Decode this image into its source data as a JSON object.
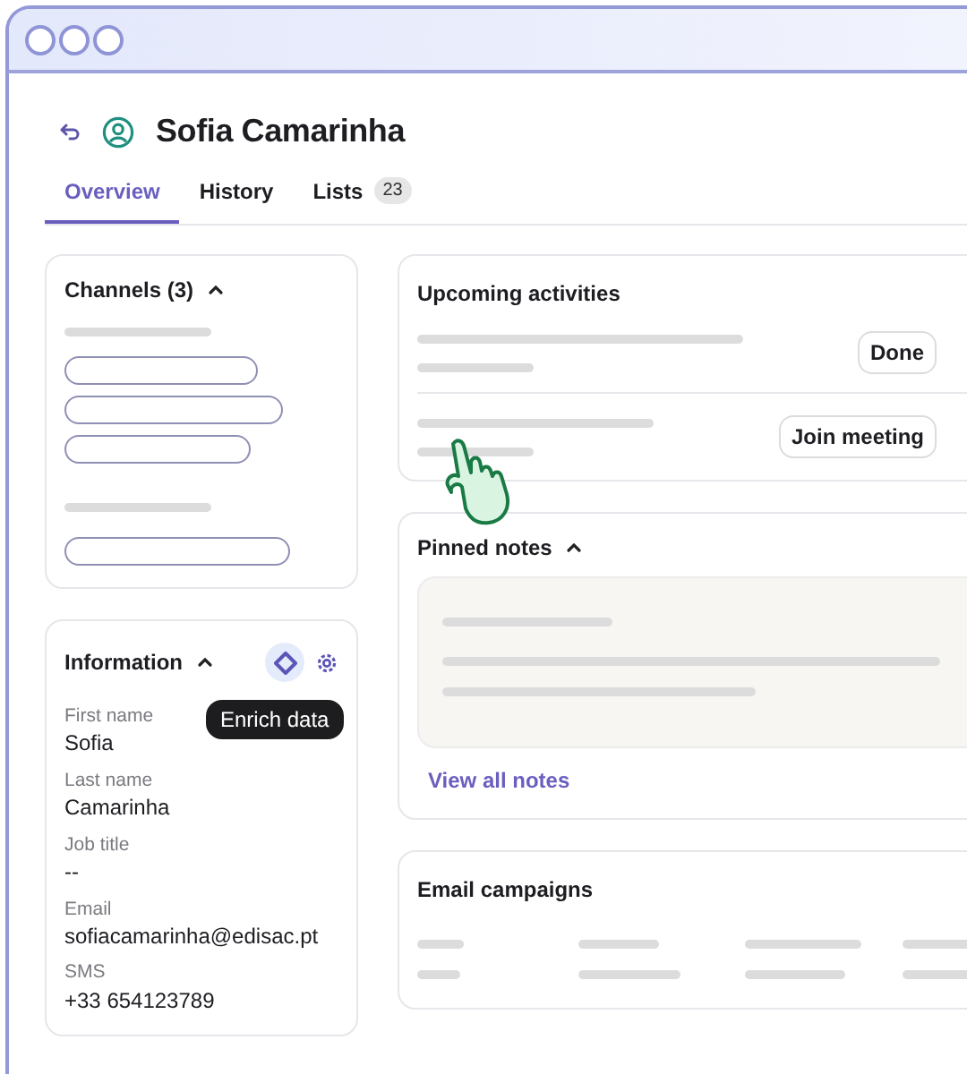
{
  "contact": {
    "name": "Sofia Camarinha"
  },
  "tabs": [
    {
      "label": "Overview",
      "selected": true
    },
    {
      "label": "History",
      "selected": false
    },
    {
      "label": "Lists",
      "badge": "23",
      "selected": false
    }
  ],
  "channels": {
    "title": "Channels (3)",
    "expanded": true
  },
  "information": {
    "title": "Information",
    "expanded": true,
    "enrich_highlighted": true,
    "tooltip": "Enrich data",
    "fields": [
      {
        "label": "First name",
        "value": "Sofia"
      },
      {
        "label": "Last name",
        "value": "Camarinha"
      },
      {
        "label": "Job title",
        "value": "--"
      },
      {
        "label": "Email",
        "value": "sofiacamarinha@edisac.pt"
      },
      {
        "label": "SMS",
        "value": "+33 654123789"
      }
    ]
  },
  "upcoming_activities": {
    "title": "Upcoming activities",
    "items": [
      {
        "action": "Done"
      },
      {
        "action": "Join meeting"
      }
    ]
  },
  "pinned_notes": {
    "title": "Pinned notes",
    "expanded": true,
    "link": "View all notes"
  },
  "email_campaigns": {
    "title": "Email campaigns"
  }
}
